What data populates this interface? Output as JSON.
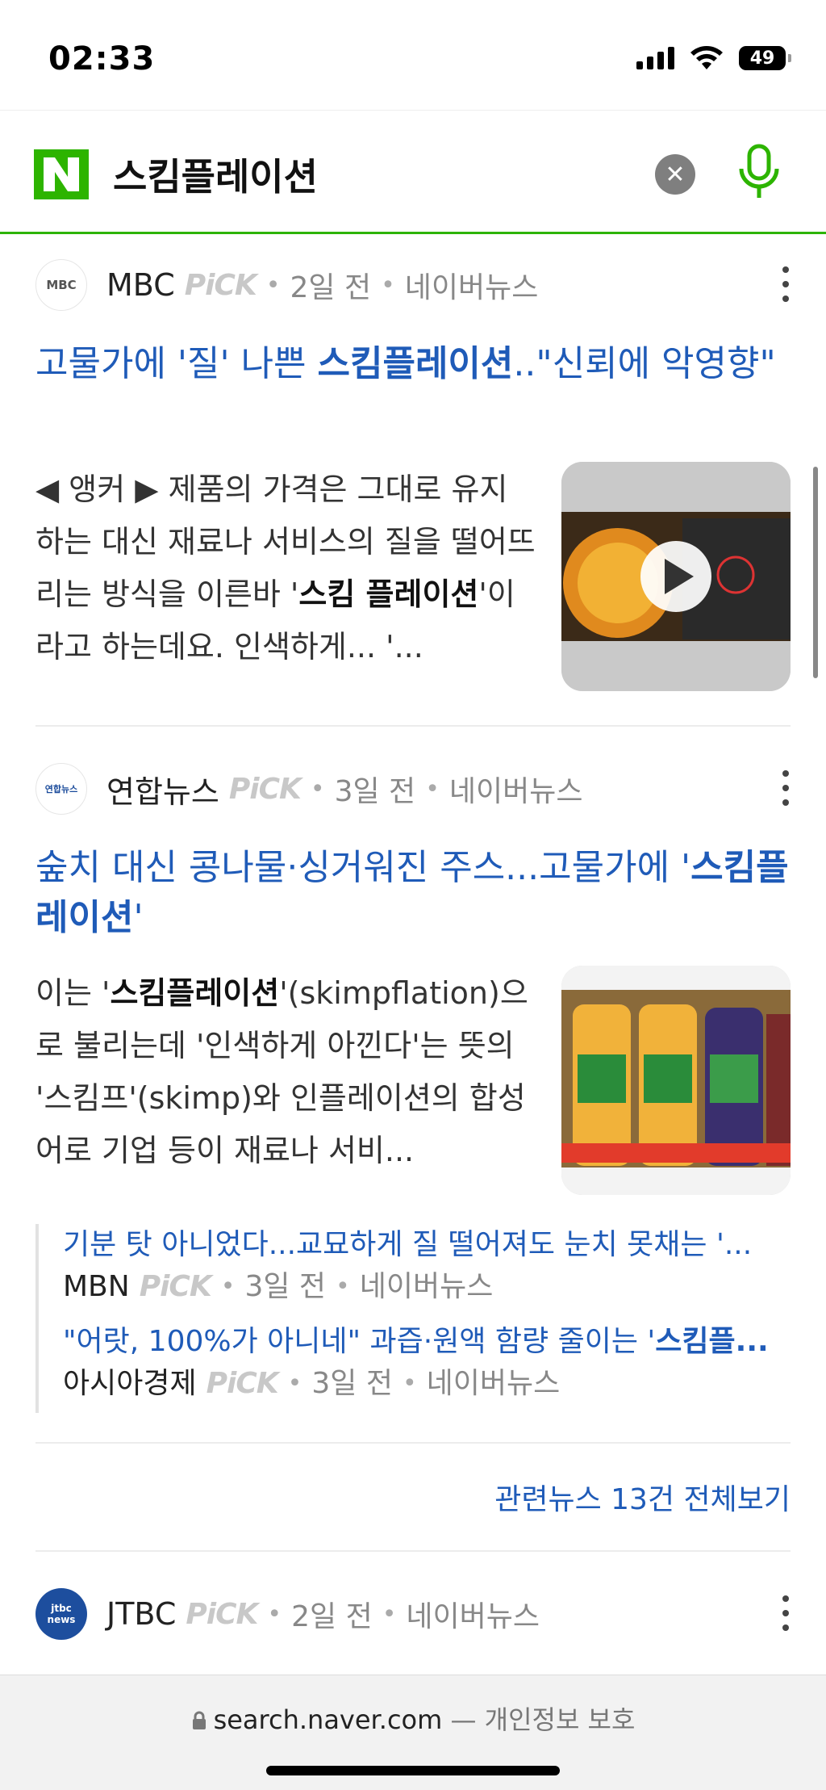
{
  "status_bar": {
    "time": "02:33",
    "battery": "49"
  },
  "search": {
    "query": "스킴플레이션",
    "clear_label": "✕"
  },
  "news": [
    {
      "press": "MBC",
      "press_logo_text": "MBC",
      "pick": "PiCK",
      "age": "2일 전",
      "source": "네이버뉴스",
      "headline_pre": "고물가에 '질' 나쁜 ",
      "headline_bold": "스킴플레이션",
      "headline_post": "..\"신뢰에 악영향\"",
      "body_pre": "◀ 앵커 ▶ 제품의 가격은 그대로 유지하는 대신 재료나 서비스의 질을 떨어뜨리는 방식을 이른바 '",
      "body_bold": "스킴 플레이션",
      "body_post": "'이라고 하는데요. 인색하게... '..."
    },
    {
      "press": "연합뉴스",
      "press_logo_text": "연합뉴스",
      "pick": "PiCK",
      "age": "3일 전",
      "source": "네이버뉴스",
      "headline_pre": "숲치 대신 콩나물·싱거워진 주스...고물가에 '",
      "headline_bold": "스킴플레이션",
      "headline_post": "'",
      "body_pre": "이는 '",
      "body_bold": "스킴플레이션",
      "body_post": "'(skimpflation)으로 불리는데 '인색하게 아낀다'는 뜻의 '스킴프'(skimp)와 인플레이션의 합성어로 기업 등이 재료나 서비...",
      "related": [
        {
          "title": "기분 탓 아니었다...교묘하게 질 떨어져도 눈치 못채는 '...",
          "press": "MBN",
          "pick": "PiCK",
          "age": "3일 전",
          "source": "네이버뉴스"
        },
        {
          "title_pre": "\"어랏, 100%가 아니네\" 과즙·원액 함량 줄이는 '",
          "title_bold": "스킴플...",
          "press": "아시아경제",
          "pick": "PiCK",
          "age": "3일 전",
          "source": "네이버뉴스"
        }
      ],
      "all_news_label": "관련뉴스 13건 전체보기"
    },
    {
      "press": "JTBC",
      "press_logo_text": "jtbc news",
      "pick": "PiCK",
      "age": "2일 전",
      "source": "네이버뉴스"
    }
  ],
  "address_bar": {
    "domain": "search.naver.com",
    "separator": " — ",
    "privacy": "개인정보 보호"
  },
  "colors": {
    "naver_green": "#2db400",
    "link_blue": "#1f5bb8"
  }
}
